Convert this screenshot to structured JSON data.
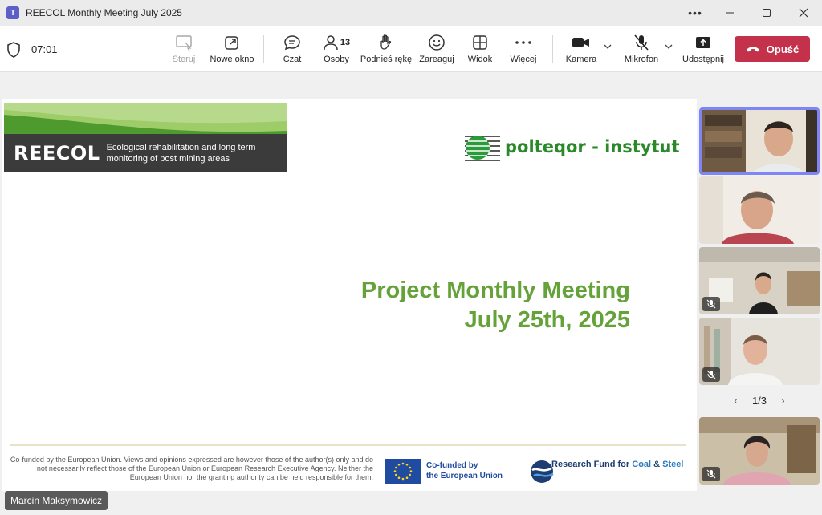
{
  "window": {
    "app_icon_glyph": "T",
    "title": "REECOL Monthly Meeting July 2025",
    "more_label": "•••"
  },
  "toolbar": {
    "timer": "07:01",
    "steruj": "Steruj",
    "nowe_okno": "Nowe okno",
    "czat": "Czat",
    "osoby": "Osoby",
    "osoby_count": "13",
    "podnies_reke": "Podnieś rękę",
    "zareaguj": "Zareaguj",
    "widok": "Widok",
    "wiecej": "Więcej",
    "kamera": "Kamera",
    "mikrofon": "Mikrofon",
    "udostepnij": "Udostępnij",
    "opusc": "Opuść"
  },
  "slide": {
    "banner_name": "REECOL",
    "banner_desc_1": "Ecological rehabilitation and long term",
    "banner_desc_2": "monitoring of post mining areas",
    "partner_logo": "polteqor - instytut",
    "title_line1": "Project Monthly Meeting",
    "title_line2": "July 25th, 2025",
    "disclaimer": "Co-funded by the European Union. Views and opinions expressed are however those of the author(s) only and do not necessarily reflect those of the European Union or European Research Executive Agency. Neither the European Union nor the granting authority can be held responsible for them.",
    "eu_line1": "Co-funded by",
    "eu_line2": "the European Union",
    "rfcs_prefix": "Research Fund for ",
    "rfcs_coal": "Coal",
    "rfcs_amp": " & ",
    "rfcs_steel": "Steel"
  },
  "participants": {
    "pager": "1/3",
    "prev": "‹",
    "next": "›"
  },
  "presenter": {
    "name": "Marcin Maksymowicz"
  },
  "colors": {
    "leave": "#c4314b",
    "active_border": "#7f85f5",
    "slide_title": "#66a23a",
    "eu_blue": "#1f4ca0"
  },
  "icons": [
    "teams-icon",
    "shield-icon",
    "share-control-icon",
    "new-window-icon",
    "chat-icon",
    "people-icon",
    "raise-hand-icon",
    "react-icon",
    "view-icon",
    "more-icon",
    "camera-icon",
    "mic-off-icon",
    "share-icon",
    "phone-icon",
    "minimize-icon",
    "maximize-icon",
    "close-icon"
  ]
}
